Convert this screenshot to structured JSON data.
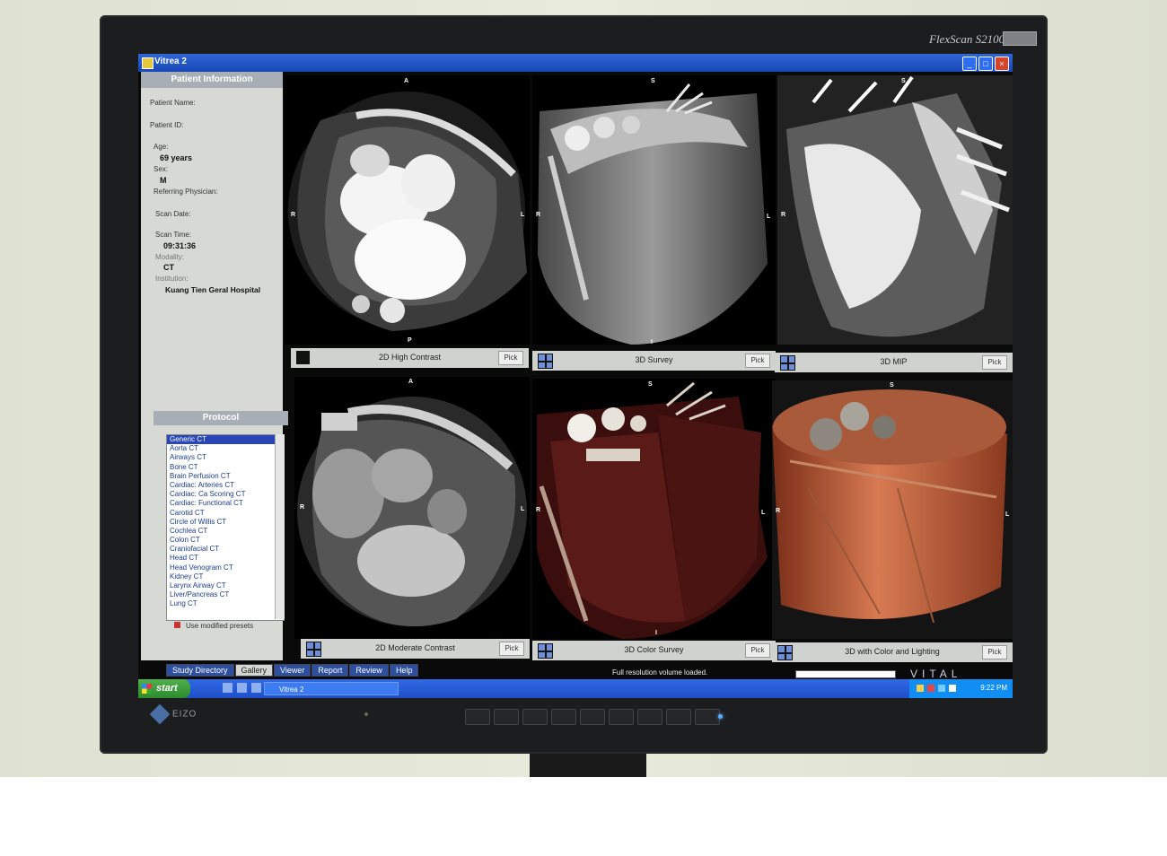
{
  "monitor": {
    "brand": "FlexScan S2100",
    "maker": "EIZO",
    "button_count": 9
  },
  "window": {
    "title": "Vitrea 2"
  },
  "patient_info": {
    "header": "Patient Information",
    "patient_name_label": "Patient Name:",
    "patient_id_label": "Patient ID:",
    "age_label": "Age:",
    "age_value": "69 years",
    "sex_label": "Sex:",
    "sex_value": "M",
    "physician_label": "Referring Physician:",
    "scan_date_label": "Scan Date:",
    "scan_time_label": "Scan Time:",
    "scan_time_value": "09:31:36",
    "modality_label": "Modality:",
    "modality_value": "CT",
    "institution_label": "Institution:",
    "institution_value": "Kuang Tien Geral Hospital"
  },
  "protocol": {
    "header": "Protocol",
    "items": [
      "Generic CT",
      "Aorta CT",
      "Airways CT",
      "Bone CT",
      "Brain Perfusion CT",
      "Cardiac: Arteries CT",
      "Cardiac: Ca Scoring CT",
      "Cardiac: Functional CT",
      "Carotid CT",
      "Circle of Willis CT",
      "Cochlea CT",
      "Colon CT",
      "Craniofacial CT",
      "Head CT",
      "Head Venogram CT",
      "Kidney CT",
      "Larynx Airway CT",
      "Liver/Pancreas CT",
      "Lung CT"
    ],
    "selected": "Generic CT",
    "preset_label": "Use modified presets"
  },
  "viewports": [
    {
      "label": "2D High Contrast",
      "pick": "Pick",
      "top": "A",
      "bottom": "P",
      "left": "R",
      "right": "L"
    },
    {
      "label": "3D Survey",
      "pick": "Pick",
      "top": "S",
      "bottom": "I",
      "left": "R",
      "right": "L"
    },
    {
      "label": "3D MIP",
      "pick": "Pick",
      "top": "S",
      "bottom": "",
      "left": "R",
      "right": "L"
    },
    {
      "label": "2D Moderate Contrast",
      "pick": "Pick",
      "top": "A",
      "bottom": "",
      "left": "R",
      "right": "L"
    },
    {
      "label": "3D Color Survey",
      "pick": "Pick",
      "top": "S",
      "bottom": "I",
      "left": "R",
      "right": "L"
    },
    {
      "label": "3D with Color and Lighting",
      "pick": "Pick",
      "top": "S",
      "bottom": "",
      "left": "R",
      "right": "L"
    }
  ],
  "tabs": [
    "Study Directory",
    "Gallery",
    "Viewer",
    "Report",
    "Review",
    "Help"
  ],
  "active_tab": "Gallery",
  "status": "Full resolution volume loaded.",
  "vendor_logo": "VITAL",
  "taskbar": {
    "start_label": "start",
    "task_label": "Vitrea 2",
    "clock": "9:22 PM"
  }
}
